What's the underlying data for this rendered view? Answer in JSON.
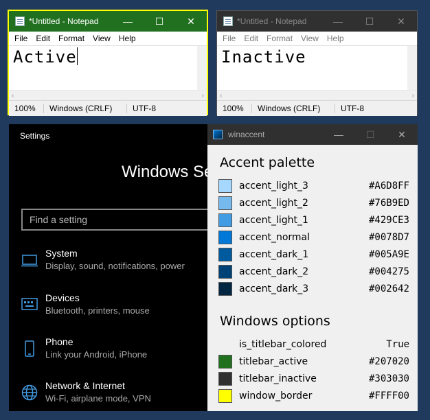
{
  "notepad_active": {
    "title": "*Untitled - Notepad",
    "minimize": "—",
    "maximize": "☐",
    "close": "✕",
    "menu": [
      "File",
      "Edit",
      "Format",
      "View",
      "Help"
    ],
    "content": "Active",
    "status": [
      "100%",
      "Windows (CRLF)",
      "UTF-8"
    ],
    "colors": {
      "titlebar": "#207020",
      "border": "#FFFF00",
      "title_text": "#ffffff"
    }
  },
  "notepad_inactive": {
    "title": "*Untitled - Notepad",
    "minimize": "—",
    "maximize": "☐",
    "close": "✕",
    "menu": [
      "File",
      "Edit",
      "Format",
      "View",
      "Help"
    ],
    "content": "Inactive",
    "status": [
      "100%",
      "Windows (CRLF)",
      "UTF-8"
    ],
    "colors": {
      "titlebar": "#303030",
      "title_text": "#8a8a8a"
    }
  },
  "settings": {
    "title": "Settings",
    "heading": "Windows Settings",
    "search_placeholder": "Find a setting",
    "categories": [
      {
        "name": "System",
        "desc": "Display, sound, notifications, power",
        "icon": "monitor-icon"
      },
      {
        "name": "Devices",
        "desc": "Bluetooth, printers, mouse",
        "icon": "keyboard-icon"
      },
      {
        "name": "Phone",
        "desc": "Link your Android, iPhone",
        "icon": "phone-icon"
      },
      {
        "name": "Network & Internet",
        "desc": "Wi-Fi, airplane mode, VPN",
        "icon": "globe-icon"
      }
    ],
    "colors": {
      "accent": "#429CE3"
    }
  },
  "winaccent": {
    "title": "winaccent",
    "minimize": "—",
    "maximize": "☐",
    "close": "✕",
    "palette_heading": "Accent palette",
    "palette": [
      {
        "name": "accent_light_3",
        "value": "#A6D8FF"
      },
      {
        "name": "accent_light_2",
        "value": "#76B9ED"
      },
      {
        "name": "accent_light_1",
        "value": "#429CE3"
      },
      {
        "name": "accent_normal",
        "value": "#0078D7"
      },
      {
        "name": "accent_dark_1",
        "value": "#005A9E"
      },
      {
        "name": "accent_dark_2",
        "value": "#004275"
      },
      {
        "name": "accent_dark_3",
        "value": "#002642"
      }
    ],
    "options_heading": "Windows options",
    "options": [
      {
        "name": "is_titlebar_colored",
        "value": "True"
      },
      {
        "name": "titlebar_active",
        "value": "#207020"
      },
      {
        "name": "titlebar_inactive",
        "value": "#303030"
      },
      {
        "name": "window_border",
        "value": "#FFFF00"
      }
    ]
  }
}
